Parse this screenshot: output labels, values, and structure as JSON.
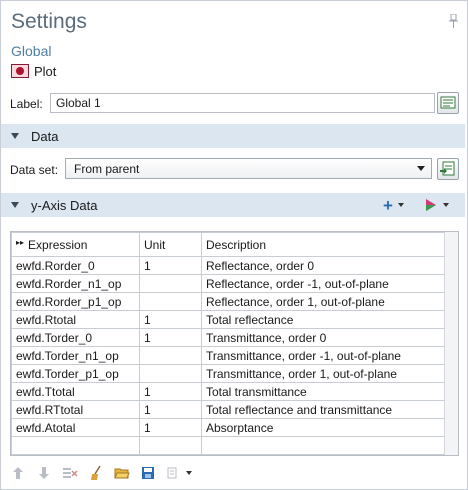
{
  "header": {
    "title": "Settings",
    "subtitle": "Global",
    "node": {
      "icon": "plot-icon",
      "label": "Plot"
    }
  },
  "label_field": {
    "label": "Label:",
    "value": "Global 1"
  },
  "sections": {
    "data": "Data",
    "y_axis": "y-Axis Data"
  },
  "dataset": {
    "label": "Data set:",
    "value": "From parent"
  },
  "table": {
    "headers": [
      "Expression",
      "Unit",
      "Description"
    ],
    "rows": [
      [
        "ewfd.Rorder_0",
        "1",
        "Reflectance, order 0"
      ],
      [
        "ewfd.Rorder_n1_op",
        "",
        "Reflectance, order -1, out-of-plane"
      ],
      [
        "ewfd.Rorder_p1_op",
        "",
        "Reflectance, order 1, out-of-plane"
      ],
      [
        "ewfd.Rtotal",
        "1",
        "Total reflectance"
      ],
      [
        "ewfd.Torder_0",
        "1",
        "Transmittance, order 0"
      ],
      [
        "ewfd.Torder_n1_op",
        "",
        "Transmittance, order -1, out-of-plane"
      ],
      [
        "ewfd.Torder_p1_op",
        "",
        "Transmittance, order 1, out-of-plane"
      ],
      [
        "ewfd.Ttotal",
        "1",
        "Total transmittance"
      ],
      [
        "ewfd.RTtotal",
        "1",
        "Total reflectance and transmittance"
      ],
      [
        "ewfd.Atotal",
        "1",
        "Absorptance"
      ],
      [
        "",
        "",
        ""
      ]
    ]
  },
  "toolbar_icons": [
    "move-up-icon",
    "move-down-icon",
    "delete-icon",
    "clear-icon",
    "open-icon",
    "save-icon",
    "more-options-icon"
  ],
  "colors": {
    "section_bg": "#dbe6f1",
    "title": "#5b6d7a",
    "link": "#4f7fa0",
    "accent_blue": "#2b6cb0"
  }
}
